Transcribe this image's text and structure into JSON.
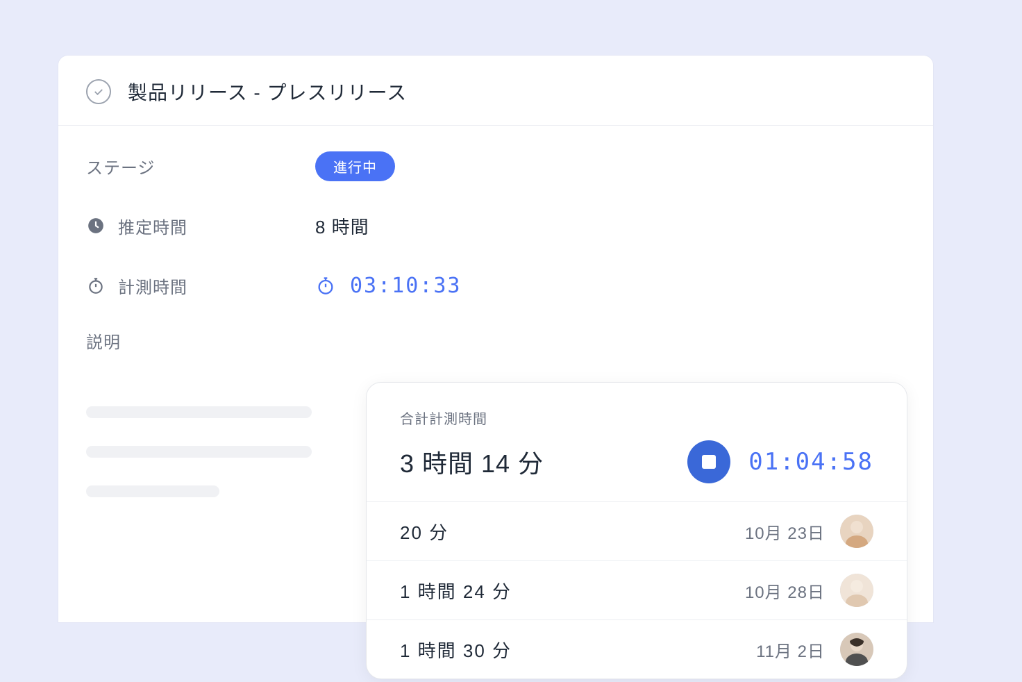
{
  "header": {
    "title": "製品リリース - プレスリリース"
  },
  "fields": {
    "stage": {
      "label": "ステージ",
      "value": "進行中"
    },
    "estimated": {
      "label": "推定時間",
      "value": "8 時間"
    },
    "tracked": {
      "label": "計測時間",
      "value": "03:10:33"
    },
    "description": {
      "label": "説明"
    }
  },
  "tracker": {
    "total_label": "合計計測時間",
    "total_value": "3 時間 14 分",
    "running": "01:04:58",
    "entries": [
      {
        "duration": "20  分",
        "date": "10月 23日"
      },
      {
        "duration": "1  時間  24  分",
        "date": "10月 28日"
      },
      {
        "duration": "1  時間  30  分",
        "date": "11月 2日"
      }
    ]
  },
  "colors": {
    "accent": "#4a72f5",
    "muted": "#6b7280",
    "text": "#1f2937"
  }
}
